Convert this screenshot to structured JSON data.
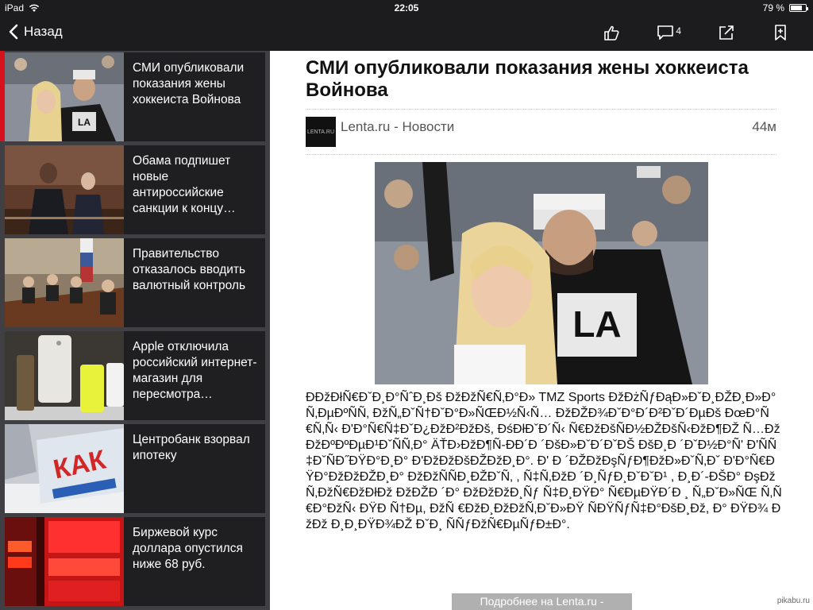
{
  "status": {
    "device": "iPad",
    "time": "22:05",
    "battery": "79 %",
    "battery_level": 0.79
  },
  "nav": {
    "back_label": "Назад",
    "comments_count": "4"
  },
  "sidebar": {
    "items": [
      {
        "title": "СМИ опубликовали показания жены хоккеиста Войнова"
      },
      {
        "title": "Обама подпишет новые антироссийские санкции к концу…"
      },
      {
        "title": "Правительство отказалось вводить валютный контроль"
      },
      {
        "title": "Apple отключила российский интернет-магазин для пересмотра…"
      },
      {
        "title": "Центробанк взорвал ипотеку"
      },
      {
        "title": "Биржевой курс доллара опустился ниже 68 руб."
      }
    ],
    "thumb5_text": "КАК"
  },
  "article": {
    "headline": "СМИ опубликовали показания жены хоккеиста Войнова",
    "source_logo": "LENTA.RU",
    "source": "Lenta.ru - Новости",
    "time_ago": "44м",
    "body": "ÐÐžÐłÑ€ÐˇÐ¸Ð°ÑˆÐ¸Ðš ÐžÐžÑ€Ñ‚Ð°Ð» TMZ Sports ÐžÐżÑƒÐąÐ»ÐˇÐ¸ÐŽÐ¸Ð»Ð° Ñ‚ÐµÐºÑÑ‚ ÐžÑ„ÐˇÑ†ÐˇÐ°Ð»ÑŒÐ½Ñ‹Ñ… ÐžÐŽÐ¾ÐˇÐ°Ð´Ð²ÐˇÐ´ÐµÐš ÐœÐ°Ñ€Ñ‚Ñ‹ Ð'Ð°Ñ€Ñ‡ÐˇÐ¿ÐžÐ²ÐžÐš, ÐśÐłÐˇÐ´Ñ‹ Ñ€ÐžÐšÑÐ½ÐŽÐšÑ‹ÐžÐ¶ÐŽ Ñ…ÐžÐžÐºÐºÐµÐ¹ÐˇÑÑ‚Ð° ÄŤÐ›ÐžÐ¶Ñ-ÐÐ´Ð ´ÐšÐ»ÐˇÐ´ÐˇÐŠ ÐšÐ¸Ð ´ÐˇÐ½Ð°Ñ' Ð'ÑÑ‡ÐˇÑÐ˝ÐŸÐ°Ð¸Ð° Ð'ÐžÐžÐšÐŽÐžÐ¸Ð°. Ð' Ð ´ÐŽÐžÐşÑƒÐ¶ÐžÐ»ÐˇÑ‚Ðˇ Ð'Ð°Ñ€ÐŸÐ°ÐžÐžÐŽÐ¸Ð° ÐžÐžÑÑÐ¸ÐŽÐˇÑ‚ , Ñ‡Ñ‚ÐžÐ ´Ð¸ÑƒÐ¸ÐˇÐˇÐ¹ , Ð¸Ð´-ÐŠÐ° ÐşÐžÑ‚ÐžÑ€ÐžÐłÐž ÐžÐŽÐ ´Ð° ÐžÐžÐžÐ¸Ñƒ Ñ‡Ð¸ÐŸÐ° Ñ€ÐµÐŸÐ´Ð ¸ Ñ„ÐˇÐ»ÑŒ Ñ‚Ñ€Ð°ÐžÑ‹ ÐŸÐ Ñ†Ðµ, ÐžÑ €ÐžÐ¸ÐžÐžÑ‚ÐˇÐ»ÐŸ ÑÐŸÑƒÑ‡Ð°ÐšÐ¸Ðž, Ð° ÐŸÐ¾ ÐžÐž Ð¸Ð¸ÐŸÐ¾ÐŽ ÐˇÐ¸ ÑÑƒÐžÑ€ÐµÑƒÐ±Ð°."
  },
  "more_label": "Подробнее на Lenta.ru -",
  "watermark": "pikabu.ru"
}
